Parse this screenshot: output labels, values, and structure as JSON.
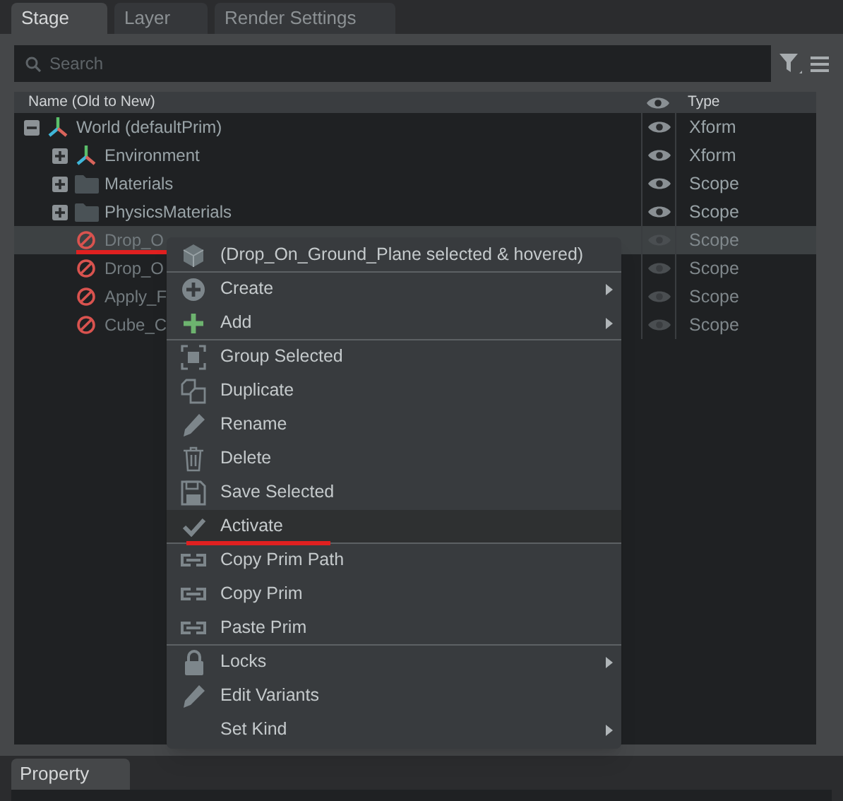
{
  "tabs": [
    {
      "label": "Stage",
      "selected": true
    },
    {
      "label": "Layer",
      "selected": false
    },
    {
      "label": "Render Settings",
      "selected": false
    }
  ],
  "search": {
    "placeholder": "Search"
  },
  "columns": [
    "Name (Old to New)",
    "Type"
  ],
  "tree": [
    {
      "label": "World (defaultPrim)",
      "kind": "xform",
      "type": "Xform",
      "expanded": true,
      "active": true,
      "selected": false,
      "children": [
        {
          "label": "Environment",
          "kind": "xform",
          "type": "Xform",
          "expanded": false,
          "active": true,
          "selected": false
        },
        {
          "label": "Materials",
          "kind": "scope",
          "type": "Scope",
          "expanded": false,
          "active": true,
          "selected": false
        },
        {
          "label": "PhysicsMaterials",
          "kind": "scope",
          "type": "Scope",
          "expanded": false,
          "active": true,
          "selected": false
        },
        {
          "label": "Drop_O",
          "kind": "scope",
          "type": "Scope",
          "active": false,
          "selected": true,
          "underlined": true
        },
        {
          "label": "Drop_O",
          "kind": "scope",
          "type": "Scope",
          "active": false,
          "selected": false
        },
        {
          "label": "Apply_F",
          "kind": "scope",
          "type": "Scope",
          "active": false,
          "selected": false
        },
        {
          "label": "Cube_C",
          "kind": "scope",
          "type": "Scope",
          "active": false,
          "selected": false
        }
      ]
    }
  ],
  "context_menu": [
    {
      "label": "(Drop_On_Ground_Plane selected & hovered)",
      "submenu": false,
      "separator_after": true,
      "selected": false
    },
    {
      "label": "Create",
      "submenu": true,
      "separator_after": false,
      "selected": false
    },
    {
      "label": "Add",
      "submenu": true,
      "separator_after": true,
      "selected": false
    },
    {
      "label": "Group Selected",
      "submenu": false,
      "separator_after": false,
      "selected": false
    },
    {
      "label": "Duplicate",
      "submenu": false,
      "separator_after": false,
      "selected": false
    },
    {
      "label": "Rename",
      "submenu": false,
      "separator_after": false,
      "selected": false
    },
    {
      "label": "Delete",
      "submenu": false,
      "separator_after": false,
      "selected": false
    },
    {
      "label": "Save Selected",
      "submenu": false,
      "separator_after": false,
      "selected": false
    },
    {
      "label": "Activate",
      "submenu": false,
      "separator_after": true,
      "selected": true,
      "underlined": true
    },
    {
      "label": "Copy Prim Path",
      "submenu": false,
      "separator_after": false,
      "selected": false
    },
    {
      "label": "Copy Prim",
      "submenu": false,
      "separator_after": false,
      "selected": false
    },
    {
      "label": "Paste Prim",
      "submenu": false,
      "separator_after": true,
      "selected": false
    },
    {
      "label": "Locks",
      "submenu": true,
      "separator_after": false,
      "selected": false
    },
    {
      "label": "Edit Variants",
      "submenu": false,
      "separator_after": false,
      "selected": false
    },
    {
      "label": "Set Kind",
      "submenu": true,
      "separator_after": false,
      "selected": false
    }
  ],
  "bottom_tabs": [
    {
      "label": "Property",
      "selected": true
    }
  ]
}
